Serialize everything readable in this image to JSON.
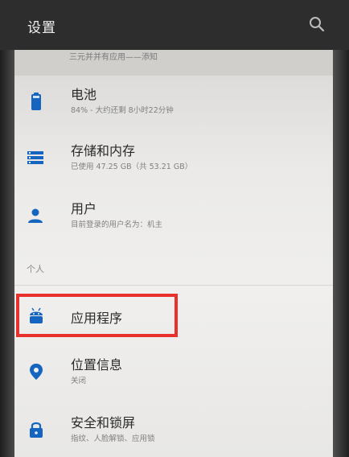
{
  "appbar": {
    "title": "设置",
    "search_icon": "search-icon"
  },
  "partial_item": {
    "subtitle": "三元并并有应用——添知"
  },
  "items": [
    {
      "title": "电池",
      "subtitle": "84% - 大约还剩 8小时22分钟",
      "icon": "battery-icon"
    },
    {
      "title": "存储和内存",
      "subtitle": "已使用 47.25 GB（共 53.21 GB）",
      "icon": "storage-icon"
    },
    {
      "title": "用户",
      "subtitle": "目前登录的用户名为：机主",
      "icon": "user-icon"
    }
  ],
  "section": {
    "label": "个人"
  },
  "personal_items": [
    {
      "title": "应用程序",
      "icon": "android-icon"
    },
    {
      "title": "位置信息",
      "subtitle": "关闭",
      "icon": "location-icon"
    },
    {
      "title": "安全和锁屏",
      "subtitle": "指纹、人脸解锁、应用锁",
      "icon": "lock-icon"
    }
  ],
  "colors": {
    "accent": "#1565c0",
    "highlight": "#e8302f",
    "appbar": "#2d2d2d"
  }
}
